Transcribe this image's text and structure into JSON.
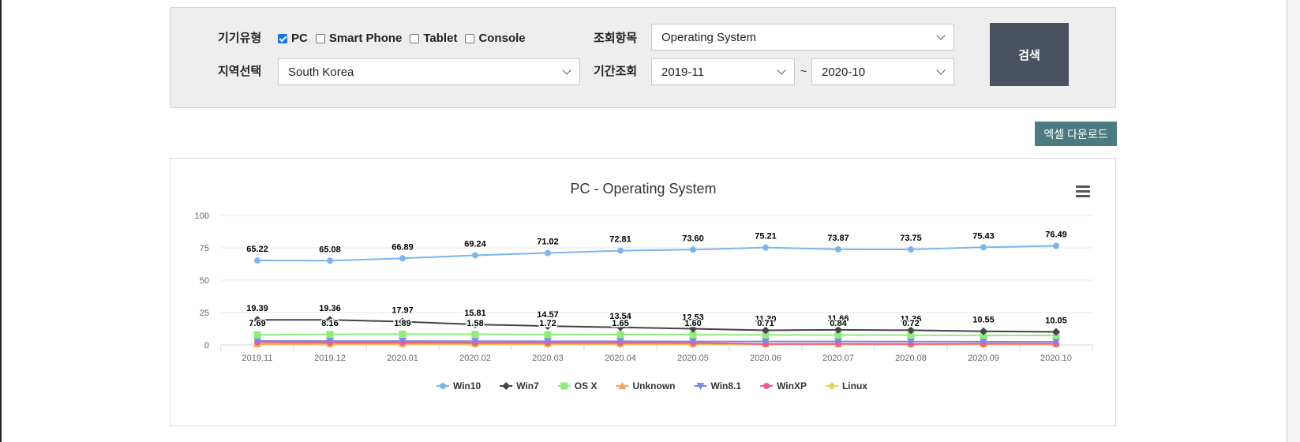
{
  "filters": {
    "device_type_label": "기기유형",
    "device_options": [
      {
        "label": "PC",
        "checked": true
      },
      {
        "label": "Smart Phone",
        "checked": false
      },
      {
        "label": "Tablet",
        "checked": false
      },
      {
        "label": "Console",
        "checked": false
      }
    ],
    "query_item_label": "조회항목",
    "query_item_value": "Operating System",
    "region_label": "지역선택",
    "region_value": "South Korea",
    "period_label": "기간조회",
    "period_from": "2019-11",
    "period_separator": "~",
    "period_to": "2020-10",
    "search_button": "검색"
  },
  "excel_button": "엑셀 다운로드",
  "colors": {
    "search_button": "#4a5261",
    "excel_button": "#4b7b82",
    "panel_bg": "#eeeeee"
  },
  "chart_data": {
    "type": "line",
    "title": "PC - Operating System",
    "categories": [
      "2019.11",
      "2019.12",
      "2020.01",
      "2020.02",
      "2020.03",
      "2020.04",
      "2020.05",
      "2020.06",
      "2020.07",
      "2020.08",
      "2020.09",
      "2020.10"
    ],
    "y_ticks": [
      0,
      25,
      50,
      75,
      100
    ],
    "ylim": [
      0,
      100
    ],
    "grid": true,
    "legend_position": "bottom-center",
    "series": [
      {
        "name": "Win10",
        "color": "#7cb5ec",
        "marker": "circle",
        "show_labels": true,
        "values": [
          65.22,
          65.08,
          66.89,
          69.24,
          71.02,
          72.81,
          73.6,
          75.21,
          73.87,
          73.75,
          75.43,
          76.49
        ]
      },
      {
        "name": "Win7",
        "color": "#434348",
        "marker": "diamond",
        "show_labels": true,
        "values": [
          19.39,
          19.36,
          17.97,
          15.81,
          14.57,
          13.54,
          12.53,
          11.3,
          11.66,
          11.36,
          10.55,
          10.05
        ]
      },
      {
        "name": "OS X",
        "color": "#90ed7d",
        "marker": "square",
        "show_labels": false,
        "values": [
          7.69,
          8.16,
          8.3,
          8.2,
          8.0,
          7.9,
          7.9,
          7.7,
          7.6,
          7.5,
          7.4,
          7.3
        ]
      },
      {
        "name": "Unknown",
        "color": "#f7a35c",
        "marker": "triangle",
        "show_labels": false,
        "values": [
          0.8,
          0.9,
          1.0,
          1.0,
          0.9,
          0.9,
          0.9,
          0.8,
          0.8,
          0.8,
          0.8,
          0.8
        ]
      },
      {
        "name": "Win8.1",
        "color": "#8085e9",
        "marker": "triangle-down",
        "show_labels": false,
        "values": [
          3.1,
          3.0,
          3.0,
          2.9,
          2.8,
          2.8,
          2.7,
          2.7,
          2.7,
          2.6,
          2.5,
          2.4
        ]
      },
      {
        "name": "WinXP",
        "color": "#f15c80",
        "marker": "circle",
        "show_labels": false,
        "values": [
          2.1,
          1.9,
          1.89,
          1.58,
          1.72,
          1.65,
          1.6,
          0.71,
          0.84,
          0.72,
          1.0,
          0.9
        ]
      },
      {
        "name": "Linux",
        "color": "#e4d354",
        "marker": "diamond",
        "show_labels": false,
        "values": [
          0.3,
          0.3,
          0.3,
          0.3,
          0.3,
          0.3,
          0.3,
          0.3,
          0.3,
          0.3,
          0.3,
          0.3
        ]
      }
    ],
    "data_labels": {
      "Win10": [
        "65.22",
        "65.08",
        "66.89",
        "69.24",
        "71.02",
        "72.81",
        "73.60",
        "75.21",
        "73.87",
        "73.75",
        "75.43",
        "76.49"
      ],
      "Win7": [
        "19.39",
        "19.36",
        "17.97",
        "15.81",
        "14.57",
        "13.54",
        "12.53",
        "11.30",
        "11.66",
        "11.36",
        "10.55",
        "10.05"
      ],
      "third_row": [
        "7.69",
        "8.16",
        "1.89",
        "1.58",
        "1.72",
        "1.65",
        "1.60",
        "0.71",
        "0.84",
        "0.72",
        "",
        ""
      ]
    }
  }
}
